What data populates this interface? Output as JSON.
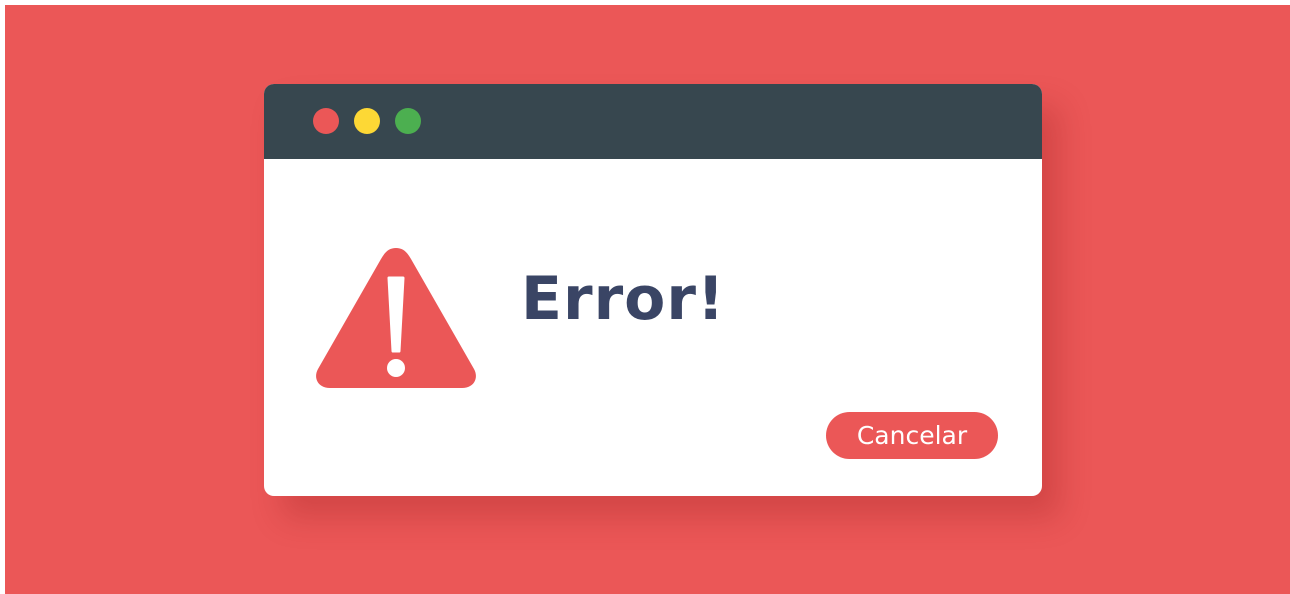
{
  "window": {
    "title_bar_color": "#37474f",
    "traffic_lights": [
      {
        "name": "close",
        "color": "#eb5757"
      },
      {
        "name": "minimize",
        "color": "#fdd835"
      },
      {
        "name": "maximize",
        "color": "#4caf50"
      }
    ]
  },
  "dialog": {
    "icon": "warning-triangle-icon",
    "icon_color": "#eb5757",
    "title": "Error!",
    "title_color": "#3a4565",
    "cancel_label": "Cancelar",
    "button_color": "#eb5757"
  },
  "colors": {
    "background": "#eb5757",
    "window": "#ffffff"
  }
}
